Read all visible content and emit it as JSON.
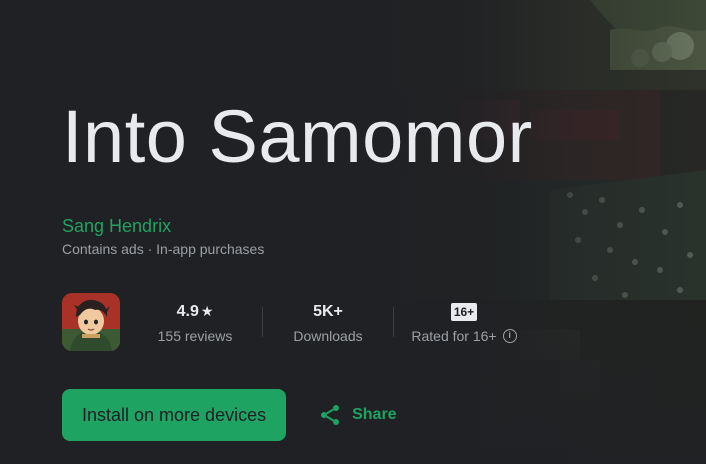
{
  "app": {
    "title": "Into Samomor",
    "developer": "Sang Hendrix",
    "meta": "Contains ads · In-app purchases"
  },
  "stats": {
    "rating_value": "4.9",
    "rating_star": "★",
    "reviews_label": "155 reviews",
    "downloads_value": "5K+",
    "downloads_label": "Downloads",
    "age_badge": "16+",
    "age_label": "Rated for 16+",
    "info_glyph": "i"
  },
  "actions": {
    "install_label": "Install on more devices",
    "share_label": "Share"
  },
  "icons": {
    "app_icon": "game-character-icon",
    "star": "star-icon",
    "info": "info-icon",
    "share": "share-icon"
  },
  "colors": {
    "background": "#202124",
    "accent": "#1ea362",
    "text_primary": "#e8eaed",
    "text_secondary": "#9aa0a6"
  }
}
